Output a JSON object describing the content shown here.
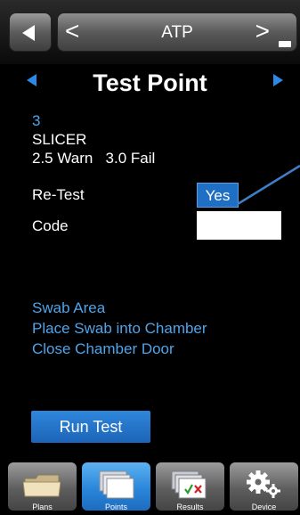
{
  "header": {
    "title": "ATP",
    "prev_glyph": "<",
    "next_glyph": ">"
  },
  "page": {
    "title": "Test Point"
  },
  "test_point": {
    "number": "3",
    "name": "SLICER",
    "thresholds": "2.5 Warn   3.0 Fail",
    "retest_label": "Re-Test",
    "retest_value": "Yes",
    "code_label": "Code",
    "code_value": ""
  },
  "instructions": [
    "Swab Area",
    "Place Swab into Chamber",
    "Close Chamber Door"
  ],
  "actions": {
    "run_test": "Run Test"
  },
  "tabs": [
    {
      "label": "Plans",
      "icon": "folder-icon"
    },
    {
      "label": "Points",
      "icon": "pages-icon"
    },
    {
      "label": "Results",
      "icon": "results-icon"
    },
    {
      "label": "Device",
      "icon": "gear-icon"
    }
  ],
  "colors": {
    "accent": "#2c8ae6",
    "text_blue": "#4fa4ea",
    "background": "#000000"
  }
}
